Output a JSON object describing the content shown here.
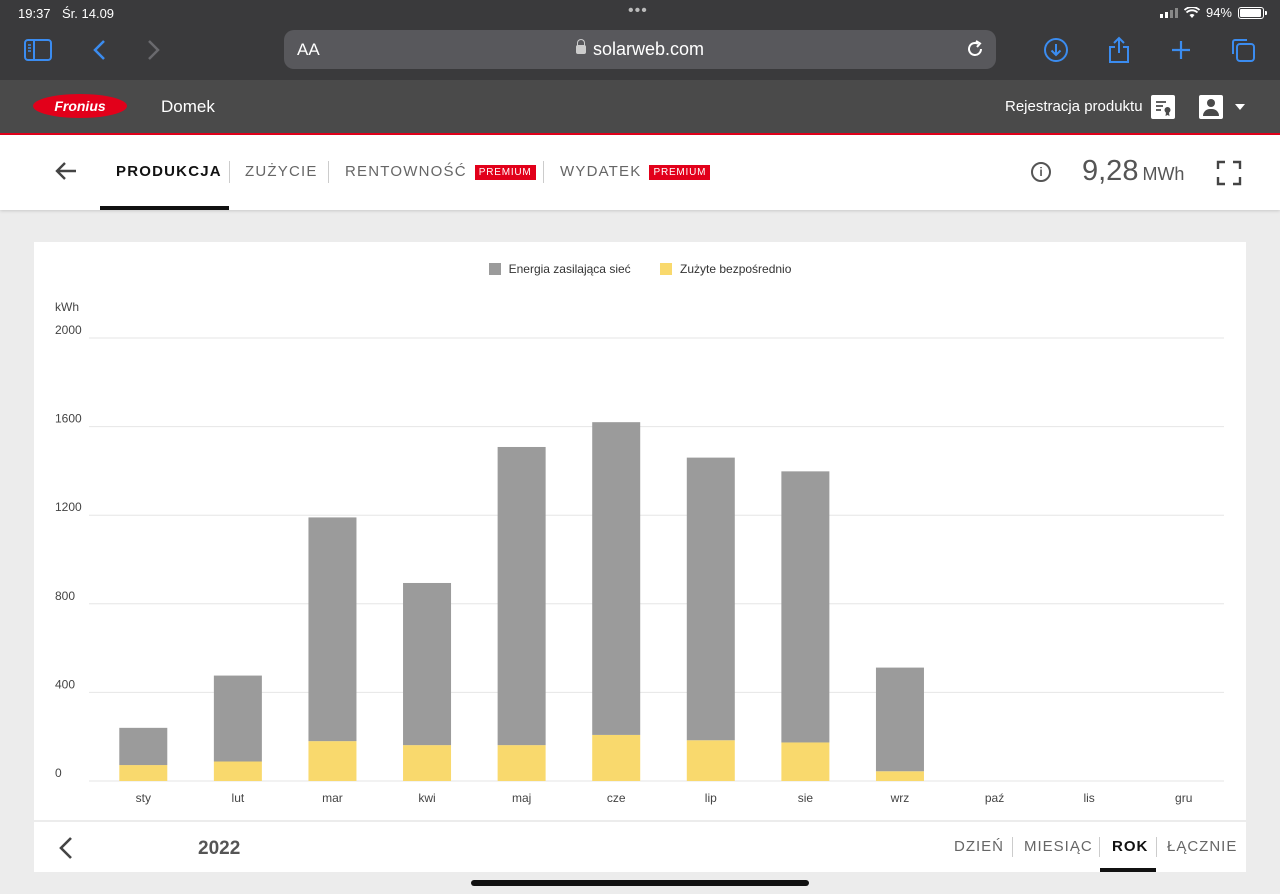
{
  "status_bar": {
    "time": "19:37",
    "date": "Śr. 14.09",
    "battery": "94%"
  },
  "browser": {
    "text_size": "AA",
    "url": "solarweb.com"
  },
  "header": {
    "brand": "Fronius",
    "site_name": "Domek",
    "register_label": "Rejestracja produktu"
  },
  "nav": {
    "tabs": [
      {
        "label": "PRODUKCJA"
      },
      {
        "label": "ZUŻYCIE"
      },
      {
        "label": "RENTOWNOŚĆ",
        "badge": "PREMIUM"
      },
      {
        "label": "WYDATEK",
        "badge": "PREMIUM"
      }
    ],
    "total_value": "9,28",
    "total_unit": "MWh"
  },
  "colors": {
    "grid_feed": "#9b9b9b",
    "self_consumed": "#f9d96d",
    "brand": "#e2001a"
  },
  "chart_data": {
    "type": "bar",
    "stacked": true,
    "categories": [
      "sty",
      "lut",
      "mar",
      "kwi",
      "maj",
      "cze",
      "lip",
      "sie",
      "wrz",
      "paź",
      "lis",
      "gru"
    ],
    "series": [
      {
        "name": "Zużyte bezpośrednio",
        "values": [
          72,
          88,
          180,
          162,
          162,
          208,
          184,
          174,
          44,
          0,
          0,
          0
        ]
      },
      {
        "name": "Energia zasilająca sieć",
        "values": [
          168,
          388,
          1010,
          732,
          1346,
          1412,
          1276,
          1224,
          468,
          0,
          0,
          0
        ]
      }
    ],
    "ylabel": "kWh",
    "yticks": [
      0,
      400,
      800,
      1200,
      1600,
      2000
    ],
    "ylim": [
      0,
      2000
    ],
    "legend": "top"
  },
  "footer": {
    "year": "2022",
    "periods": [
      "DZIEŃ",
      "MIESIĄC",
      "ROK",
      "ŁĄCZNIE"
    ]
  }
}
